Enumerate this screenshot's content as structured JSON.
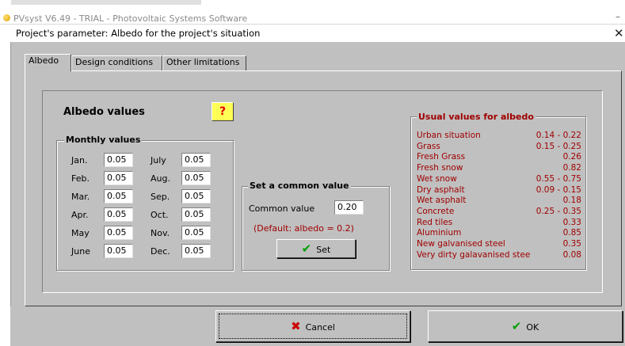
{
  "bg_window": {
    "title": "PVsyst V6.49 - TRIAL - Photovoltaic Systems Software",
    "min_glyph": "–"
  },
  "dialog": {
    "title": "Project's parameter: Albedo for the project's situation",
    "close_glyph": "✕"
  },
  "tabs": [
    "Albedo",
    "Design conditions",
    "Other limitations"
  ],
  "albedo": {
    "heading": "Albedo values",
    "help_label": "?",
    "monthly_title": "Monthly values",
    "months_left": [
      {
        "label": "Jan.",
        "value": "0.05"
      },
      {
        "label": "Feb.",
        "value": "0.05"
      },
      {
        "label": "Mar.",
        "value": "0.05"
      },
      {
        "label": "Apr.",
        "value": "0.05"
      },
      {
        "label": "May",
        "value": "0.05"
      },
      {
        "label": "June",
        "value": "0.05"
      }
    ],
    "months_right": [
      {
        "label": "July",
        "value": "0.05"
      },
      {
        "label": "Aug.",
        "value": "0.05"
      },
      {
        "label": "Sep.",
        "value": "0.05"
      },
      {
        "label": "Oct.",
        "value": "0.05"
      },
      {
        "label": "Nov.",
        "value": "0.05"
      },
      {
        "label": "Dec.",
        "value": "0.05"
      }
    ],
    "common": {
      "title": "Set a common value",
      "label": "Common value",
      "value": "0.20",
      "default_note": "(Default: albedo = 0.2)",
      "set_label": "Set"
    },
    "usual": {
      "title": "Usual values for albedo",
      "rows": [
        {
          "name": "Urban situation",
          "value": "0.14 - 0.22"
        },
        {
          "name": "Grass",
          "value": "0.15 - 0.25"
        },
        {
          "name": "Fresh Grass",
          "value": "0.26"
        },
        {
          "name": "Fresh snow",
          "value": "0.82"
        },
        {
          "name": "Wet snow",
          "value": "0.55 - 0.75"
        },
        {
          "name": "Dry asphalt",
          "value": "0.09 - 0.15"
        },
        {
          "name": "Wet asphalt",
          "value": "0.18"
        },
        {
          "name": "Concrete",
          "value": "0.25 - 0.35"
        },
        {
          "name": "Red tiles",
          "value": "0.33"
        },
        {
          "name": "Aluminium",
          "value": "0.85"
        },
        {
          "name": "New galvanised steel",
          "value": "0.35"
        },
        {
          "name": "Very dirty galavanised stee",
          "value": "0.08"
        }
      ]
    }
  },
  "buttons": {
    "cancel": "Cancel",
    "ok": "OK"
  },
  "colors": {
    "dialog_bg": "#c0c0c0",
    "usual_text": "#a00000",
    "help_bg": "#ffff55"
  }
}
